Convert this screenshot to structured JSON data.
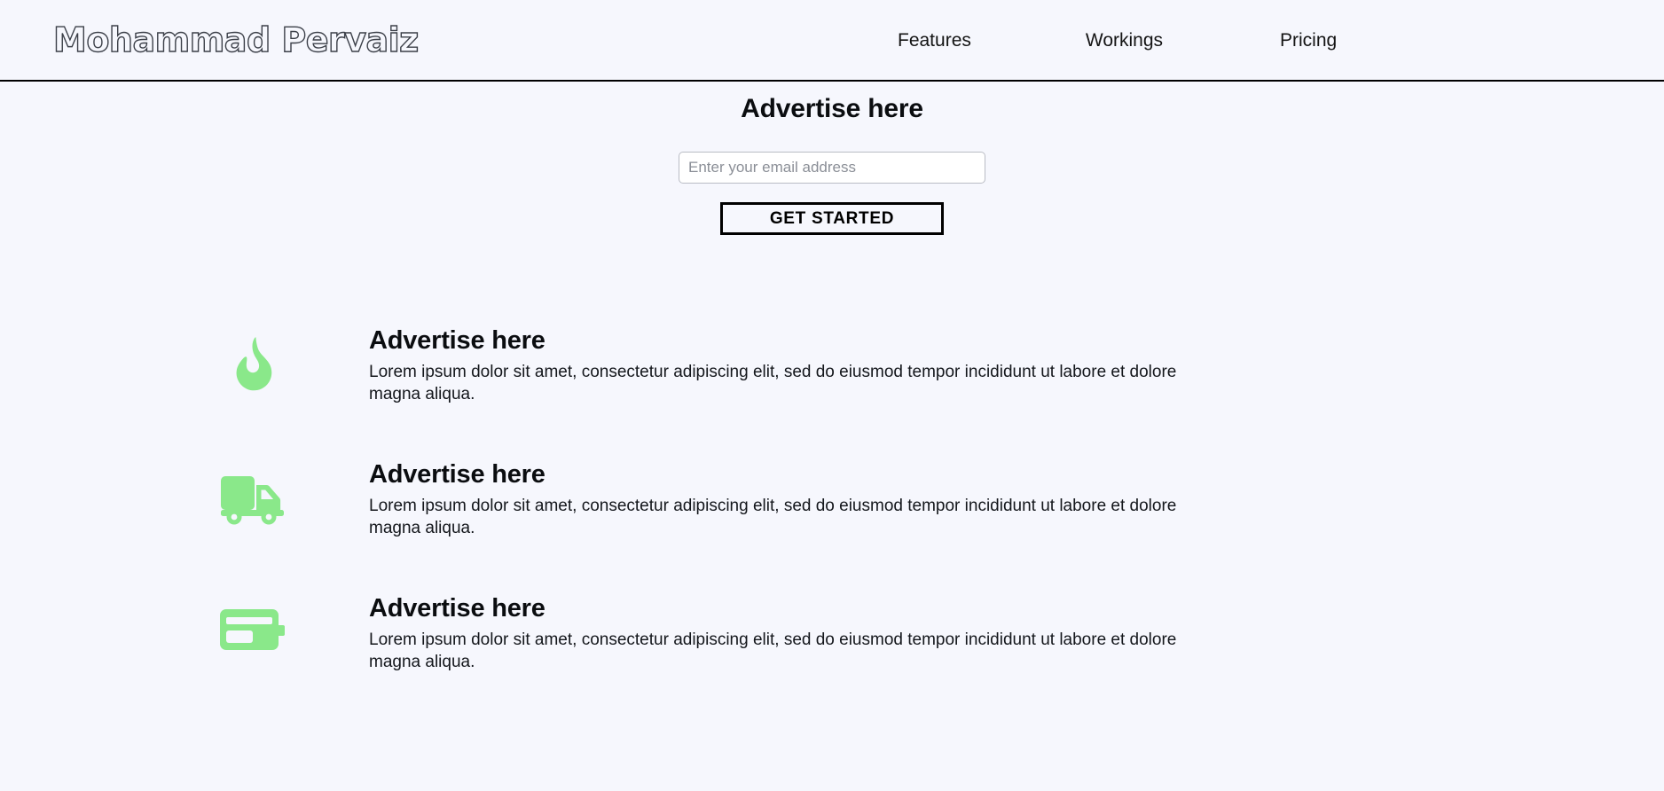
{
  "header": {
    "brand": "Mohammad Pervaiz",
    "nav": [
      {
        "label": "Features",
        "name": "features"
      },
      {
        "label": "Workings",
        "name": "workings"
      },
      {
        "label": "Pricing",
        "name": "pricing"
      }
    ]
  },
  "hero": {
    "title": "Advertise here",
    "email_value": "",
    "email_placeholder": "Enter your email address",
    "cta_label": "GET STARTED"
  },
  "features": {
    "items": [
      {
        "icon": "flame-icon",
        "title": "Advertise here",
        "description": "Lorem ipsum dolor sit amet, consectetur adipiscing elit, sed do eiusmod tempor incididunt ut labore et dolore magna aliqua."
      },
      {
        "icon": "delivery-truck-icon",
        "title": "Advertise here",
        "description": "Lorem ipsum dolor sit amet, consectetur adipiscing elit, sed do eiusmod tempor incididunt ut labore et dolore magna aliqua."
      },
      {
        "icon": "credit-card-icon",
        "title": "Advertise here",
        "description": "Lorem ipsum dolor sit amet, consectetur adipiscing elit, sed do eiusmod tempor incididunt ut labore et dolore magna aliqua."
      }
    ]
  },
  "colors": {
    "page_background": "#f6f7fd",
    "icon_green": "#8ae88a",
    "text": "#111418",
    "placeholder": "#8b8f97",
    "border_black": "#000000",
    "input_border": "#b9bcc4"
  }
}
